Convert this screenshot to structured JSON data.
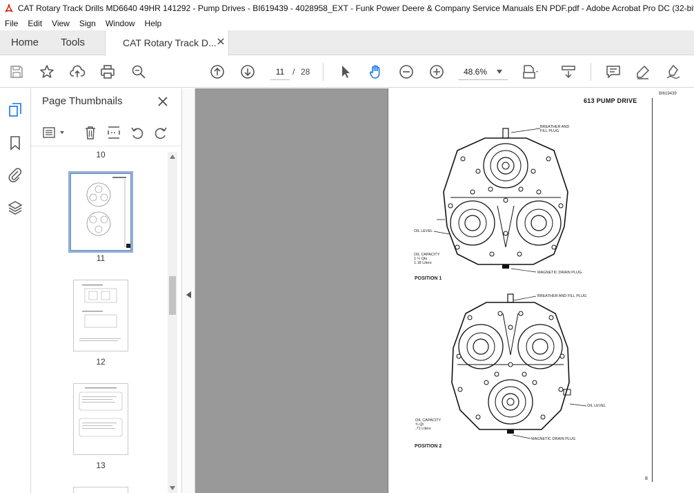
{
  "window": {
    "title": "CAT Rotary Track Drills MD6640 49HR 141292 - Pump Drives - BI619439 - 4028958_EXT - Funk Power Deere & Company Service Manuals EN PDF.pdf - Adobe Acrobat Pro DC (32-bit)"
  },
  "menu": [
    "File",
    "Edit",
    "View",
    "Sign",
    "Window",
    "Help"
  ],
  "tabs": {
    "home": "Home",
    "tools": "Tools",
    "document": "CAT Rotary Track D..."
  },
  "toolbar": {
    "current_page": "11",
    "page_separator": "/",
    "total_pages": "28",
    "zoom": "48.6%"
  },
  "thumbnails_panel": {
    "title": "Page Thumbnails",
    "pages": [
      {
        "label": "10"
      },
      {
        "label": "11",
        "selected": true
      },
      {
        "label": "12"
      },
      {
        "label": "13"
      }
    ]
  },
  "document_page": {
    "doc_id": "BI619439",
    "heading": "613 PUMP DRIVE",
    "position1": {
      "breather": [
        "BREATHER AND",
        "FILL PLUG"
      ],
      "oil_level": "OIL LEVEL",
      "capacity": [
        "OIL CAPACITY",
        "1 ¼ Qts",
        "1.18 Liters"
      ],
      "drain": "MAGNETIC DRAIN PLUG",
      "label": "POSITION 1"
    },
    "position2": {
      "breather": "BREATHER AND FILL PLUG",
      "oil_level": "OIL LEVEL",
      "capacity": [
        "OIL CAPACITY",
        "¾ Qt",
        ".71 Liters"
      ],
      "drain": "MAGNETIC DRAIN PLUG",
      "label": "POSITION 2"
    },
    "page_number": "8"
  },
  "colors": {
    "acrobat_red": "#d7261e",
    "selected_accent": "#1473e6",
    "doc_background": "#999999"
  }
}
